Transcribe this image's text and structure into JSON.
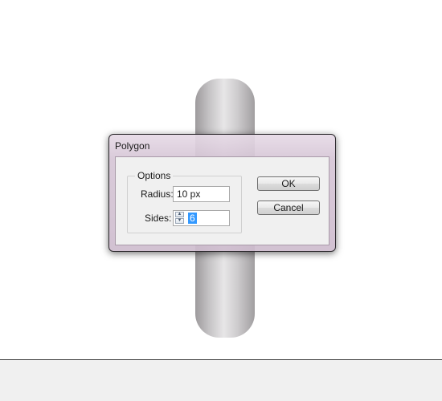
{
  "dialog": {
    "title": "Polygon",
    "options_group_label": "Options",
    "radius": {
      "label": "Radius:",
      "value": "10 px"
    },
    "sides": {
      "label": "Sides:",
      "value": "6"
    },
    "ok_label": "OK",
    "cancel_label": "Cancel"
  },
  "icons": {
    "step_up": "arrow-up-icon",
    "step_down": "arrow-down-icon"
  },
  "colors": {
    "canvas_background": "#ffffff",
    "shape_gradient_dark": "#9d9a9c",
    "shape_gradient_light": "#e7e6e7",
    "dialog_frame": "#d6c6d6",
    "selection_highlight": "#3399ff",
    "bottom_panel": "#f0f0f0"
  }
}
